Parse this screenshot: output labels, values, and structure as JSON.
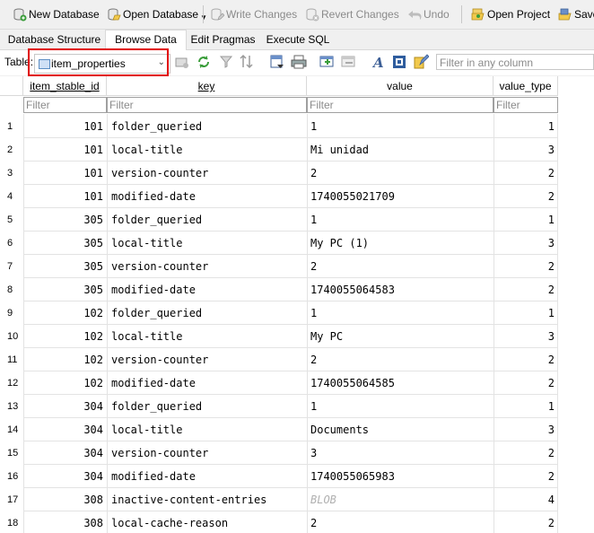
{
  "toolbar": {
    "new_database": "New Database",
    "open_database": "Open Database",
    "write_changes": "Write Changes",
    "revert_changes": "Revert Changes",
    "undo": "Undo",
    "open_project": "Open Project",
    "save_project": "Save"
  },
  "tabs": [
    "Database Structure",
    "Browse Data",
    "Edit Pragmas",
    "Execute SQL"
  ],
  "active_tab": "Browse Data",
  "browse": {
    "table_label": "Table:",
    "table_selected": "item_properties",
    "filter_any_placeholder": "Filter in any column"
  },
  "columns": [
    {
      "name": "item_stable_id",
      "filter_placeholder": "Filter"
    },
    {
      "name": "key",
      "filter_placeholder": "Filter"
    },
    {
      "name": "value",
      "filter_placeholder": "Filter"
    },
    {
      "name": "value_type",
      "filter_placeholder": "Filter"
    }
  ],
  "rows": [
    {
      "n": "1",
      "item_stable_id": "101",
      "key": "folder_queried",
      "value": "1",
      "value_type": "1"
    },
    {
      "n": "2",
      "item_stable_id": "101",
      "key": "local-title",
      "value": "Mi unidad",
      "value_type": "3"
    },
    {
      "n": "3",
      "item_stable_id": "101",
      "key": "version-counter",
      "value": "2",
      "value_type": "2"
    },
    {
      "n": "4",
      "item_stable_id": "101",
      "key": "modified-date",
      "value": "1740055021709",
      "value_type": "2"
    },
    {
      "n": "5",
      "item_stable_id": "305",
      "key": "folder_queried",
      "value": "1",
      "value_type": "1"
    },
    {
      "n": "6",
      "item_stable_id": "305",
      "key": "local-title",
      "value": "My PC (1)",
      "value_type": "3"
    },
    {
      "n": "7",
      "item_stable_id": "305",
      "key": "version-counter",
      "value": "2",
      "value_type": "2"
    },
    {
      "n": "8",
      "item_stable_id": "305",
      "key": "modified-date",
      "value": "1740055064583",
      "value_type": "2"
    },
    {
      "n": "9",
      "item_stable_id": "102",
      "key": "folder_queried",
      "value": "1",
      "value_type": "1"
    },
    {
      "n": "10",
      "item_stable_id": "102",
      "key": "local-title",
      "value": "My PC",
      "value_type": "3"
    },
    {
      "n": "11",
      "item_stable_id": "102",
      "key": "version-counter",
      "value": "2",
      "value_type": "2"
    },
    {
      "n": "12",
      "item_stable_id": "102",
      "key": "modified-date",
      "value": "1740055064585",
      "value_type": "2"
    },
    {
      "n": "13",
      "item_stable_id": "304",
      "key": "folder_queried",
      "value": "1",
      "value_type": "1"
    },
    {
      "n": "14",
      "item_stable_id": "304",
      "key": "local-title",
      "value": "Documents",
      "value_type": "3"
    },
    {
      "n": "15",
      "item_stable_id": "304",
      "key": "version-counter",
      "value": "3",
      "value_type": "2"
    },
    {
      "n": "16",
      "item_stable_id": "304",
      "key": "modified-date",
      "value": "1740055065983",
      "value_type": "2"
    },
    {
      "n": "17",
      "item_stable_id": "308",
      "key": "inactive-content-entries",
      "value": "BLOB",
      "value_type": "4"
    },
    {
      "n": "18",
      "item_stable_id": "308",
      "key": "local-cache-reason",
      "value": "2",
      "value_type": "2"
    }
  ]
}
